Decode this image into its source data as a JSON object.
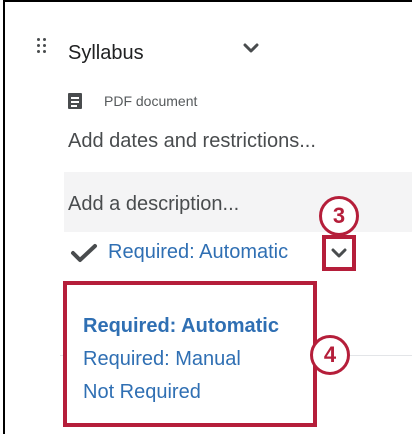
{
  "item": {
    "title": "Syllabus",
    "type_label": "PDF document",
    "add_dates_label": "Add dates and restrictions...",
    "description_placeholder": "Add a description...",
    "completion_current": "Required: Automatic"
  },
  "completion_menu": {
    "options": [
      "Required: Automatic",
      "Required: Manual",
      "Not Required"
    ],
    "selected_index": 0
  },
  "callouts": [
    "3",
    "4"
  ],
  "colors": {
    "link_blue": "#2f6fb3",
    "callout_red": "#b51e3a",
    "text_gray": "#494c4e"
  },
  "icons": [
    "drag-handle-icon",
    "chevron-down-icon",
    "document-icon",
    "checkmark-icon"
  ]
}
